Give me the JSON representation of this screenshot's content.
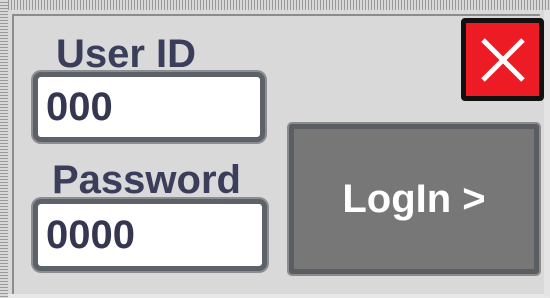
{
  "login_panel": {
    "user_id_label": "User ID",
    "user_id_value": "000",
    "password_label": "Password",
    "password_value": "0000",
    "login_button_label": "LogIn >",
    "close_icon": "close-icon"
  },
  "colors": {
    "panel_bg": "#d9d9d9",
    "label_text": "#3b3e5a",
    "login_button_bg": "#777777",
    "close_button_bg": "#ed1c24"
  }
}
